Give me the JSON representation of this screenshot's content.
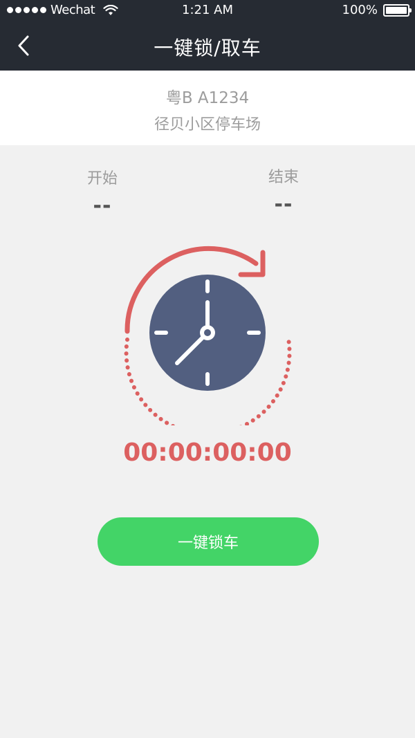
{
  "status_bar": {
    "carrier": "Wechat",
    "time": "1:21 AM",
    "battery": "100%"
  },
  "nav": {
    "title": "一键锁/取车",
    "back_icon": "chevron-left-icon"
  },
  "vehicle": {
    "plate": "粤B A1234",
    "location": "径贝小区停车场"
  },
  "session": {
    "start_label": "开始",
    "start_value": "--",
    "end_label": "结束",
    "end_value": "--"
  },
  "timer": {
    "elapsed": "00:00:00:00",
    "icon": "clock-refresh-icon"
  },
  "action": {
    "lock_label": "一键锁车"
  },
  "colors": {
    "header_bg": "#262b33",
    "accent_red": "#dc6060",
    "clock_face": "#525f80",
    "button_green": "#43d467",
    "page_bg": "#f1f1f1"
  }
}
